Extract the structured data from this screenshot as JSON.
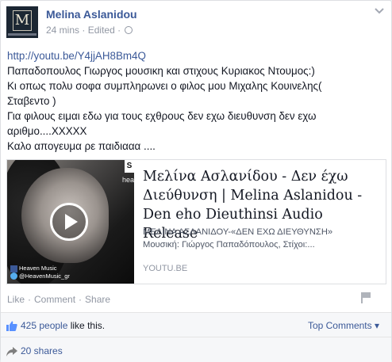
{
  "post": {
    "author": "Melina Aslanidou",
    "avatar_monogram": "M",
    "time": "24 mins",
    "separator": "·",
    "edited": "Edited",
    "menu_icon": "chevron-down-icon",
    "privacy_icon": "globe-icon",
    "lines": [
      "http://youtu.be/Y4jjAH8Bm4Q",
      "Παπαδοπουλος Γιωργος μουσικη και στιχους Κυριακος Ντουμος:)",
      "Κι οπως πολυ σοφα συμπληρωνει ο φιλος μου Μιχαλης Κουινελης(",
      "Σταβεντο )",
      "Για φιλους ειμαι εδω για τους εχθρους δεν εχω διευθυνση δεν εχω",
      "αριθμο....ΧΧΧΧΧ",
      "Καλο απογευμα ρε παιδιααα ...."
    ]
  },
  "link_card": {
    "title": "Μελίνα Ασλανίδου - Δεν έχω Διεύθυνση | Melina Aslanidou - Den eho Dieuthinsi Audio Release",
    "desc_line1": "ΜΕΛΙΝΑ ΑΣΛΑΝΙΔΟΥ-«ΔΕΝ ΕΧΩ ΔΙΕΥΘΥΝΣΗ»",
    "desc_line2": "Μουσική: Γιώργος Παπαδόπουλος, Στίχοι:...",
    "domain": "YOUTU.BE",
    "thumb_s": "S",
    "thumb_hv": "hea",
    "badge_line1": "Heaven Music",
    "badge_line2": "@HeavenMusic_gr"
  },
  "actions": {
    "like": "Like",
    "comment": "Comment",
    "share": "Share",
    "sep": "·"
  },
  "footer": {
    "likes_count": "425 people",
    "likes_suffix": " like this.",
    "top_comments": "Top Comments ▾",
    "shares": "20 shares"
  },
  "colors": {
    "link": "#3b5998",
    "meta": "#9197a3",
    "footer_bg": "#f6f7f9"
  }
}
